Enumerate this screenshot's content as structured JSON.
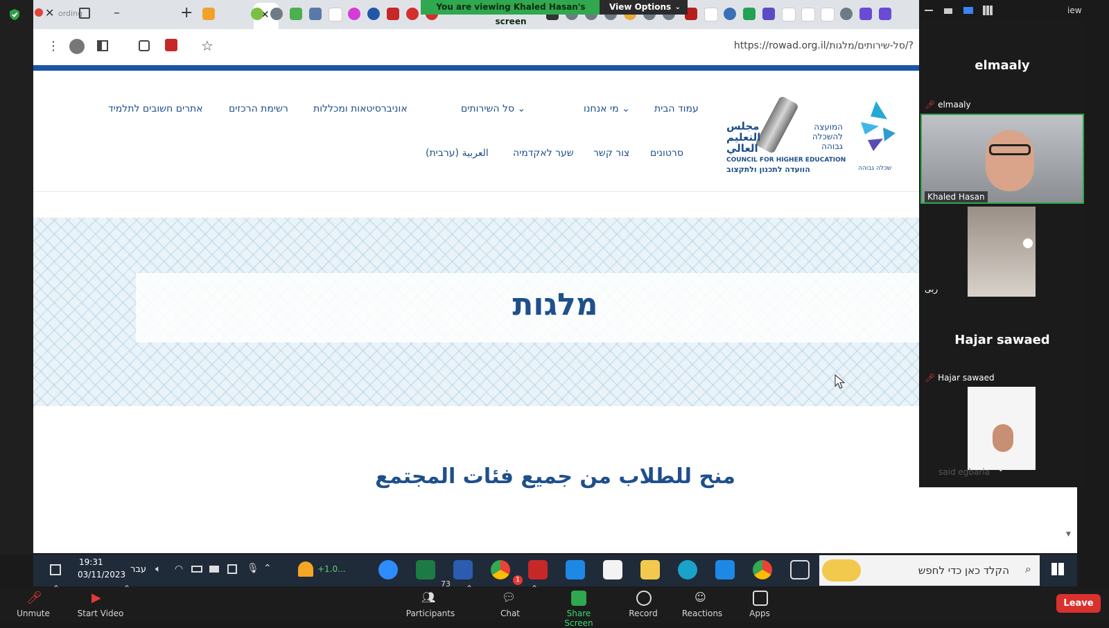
{
  "zoom_banner": {
    "viewing": "You are viewing Khaled Hasan's screen",
    "view_options": "View Options"
  },
  "browser": {
    "url": "https://rowad.org.il/סל-שירותים/מלגות/?",
    "recording": "ording"
  },
  "site": {
    "logo_council_en": "COUNCIL FOR HIGHER EDUCATION",
    "logo_council_he": "המועצה להשכלה גבוהה",
    "logo_council_ar": "مجلس التعليم العالي",
    "logo_committee_he": "הוועדה לתכנון ולתקצוב",
    "logo_partial": "שכלה גבוהה",
    "nav_row1": [
      "עמוד הבית",
      "מי אנחנו",
      "סל השירותים",
      "אוניברסיטאות ומכללות",
      "רשימת הרכזים",
      "אתרים חשובים לתלמיד"
    ],
    "nav_row2": [
      "סרטונים",
      "צור קשר",
      "שער לאקדמיה",
      "العربية (ערבית)"
    ],
    "hero_title": "מלגות",
    "subtitle": "منح للطلاب من جميع فئات المجتمع"
  },
  "participants_panel": {
    "title_right": "iew",
    "p1_big": "elmaaly",
    "p1_tag": "elmaaly",
    "p2_tag": "Khaled Hasan",
    "p3_tag": "ربى",
    "p4_big": "Hajar sawaed",
    "p4_tag": "Hajar sawaed",
    "p5_tag": "said egbaria"
  },
  "taskbar": {
    "time": "19:31",
    "date": "03/11/2023",
    "lang": "עבר",
    "weather": "+1.0...",
    "search_placeholder": "הקלד כאן כדי לחפש",
    "chat_badge": "1"
  },
  "zoom_toolbar": {
    "unmute": "Unmute",
    "start_video": "Start Video",
    "participants": "Participants",
    "participants_count": "73",
    "chat": "Chat",
    "share_screen": "Share Screen",
    "record": "Record",
    "reactions": "Reactions",
    "apps": "Apps",
    "leave": "Leave"
  },
  "colors": {
    "zoom_green": "#2fa84f",
    "site_blue": "#1f4f8c",
    "leave_red": "#d9322e"
  }
}
